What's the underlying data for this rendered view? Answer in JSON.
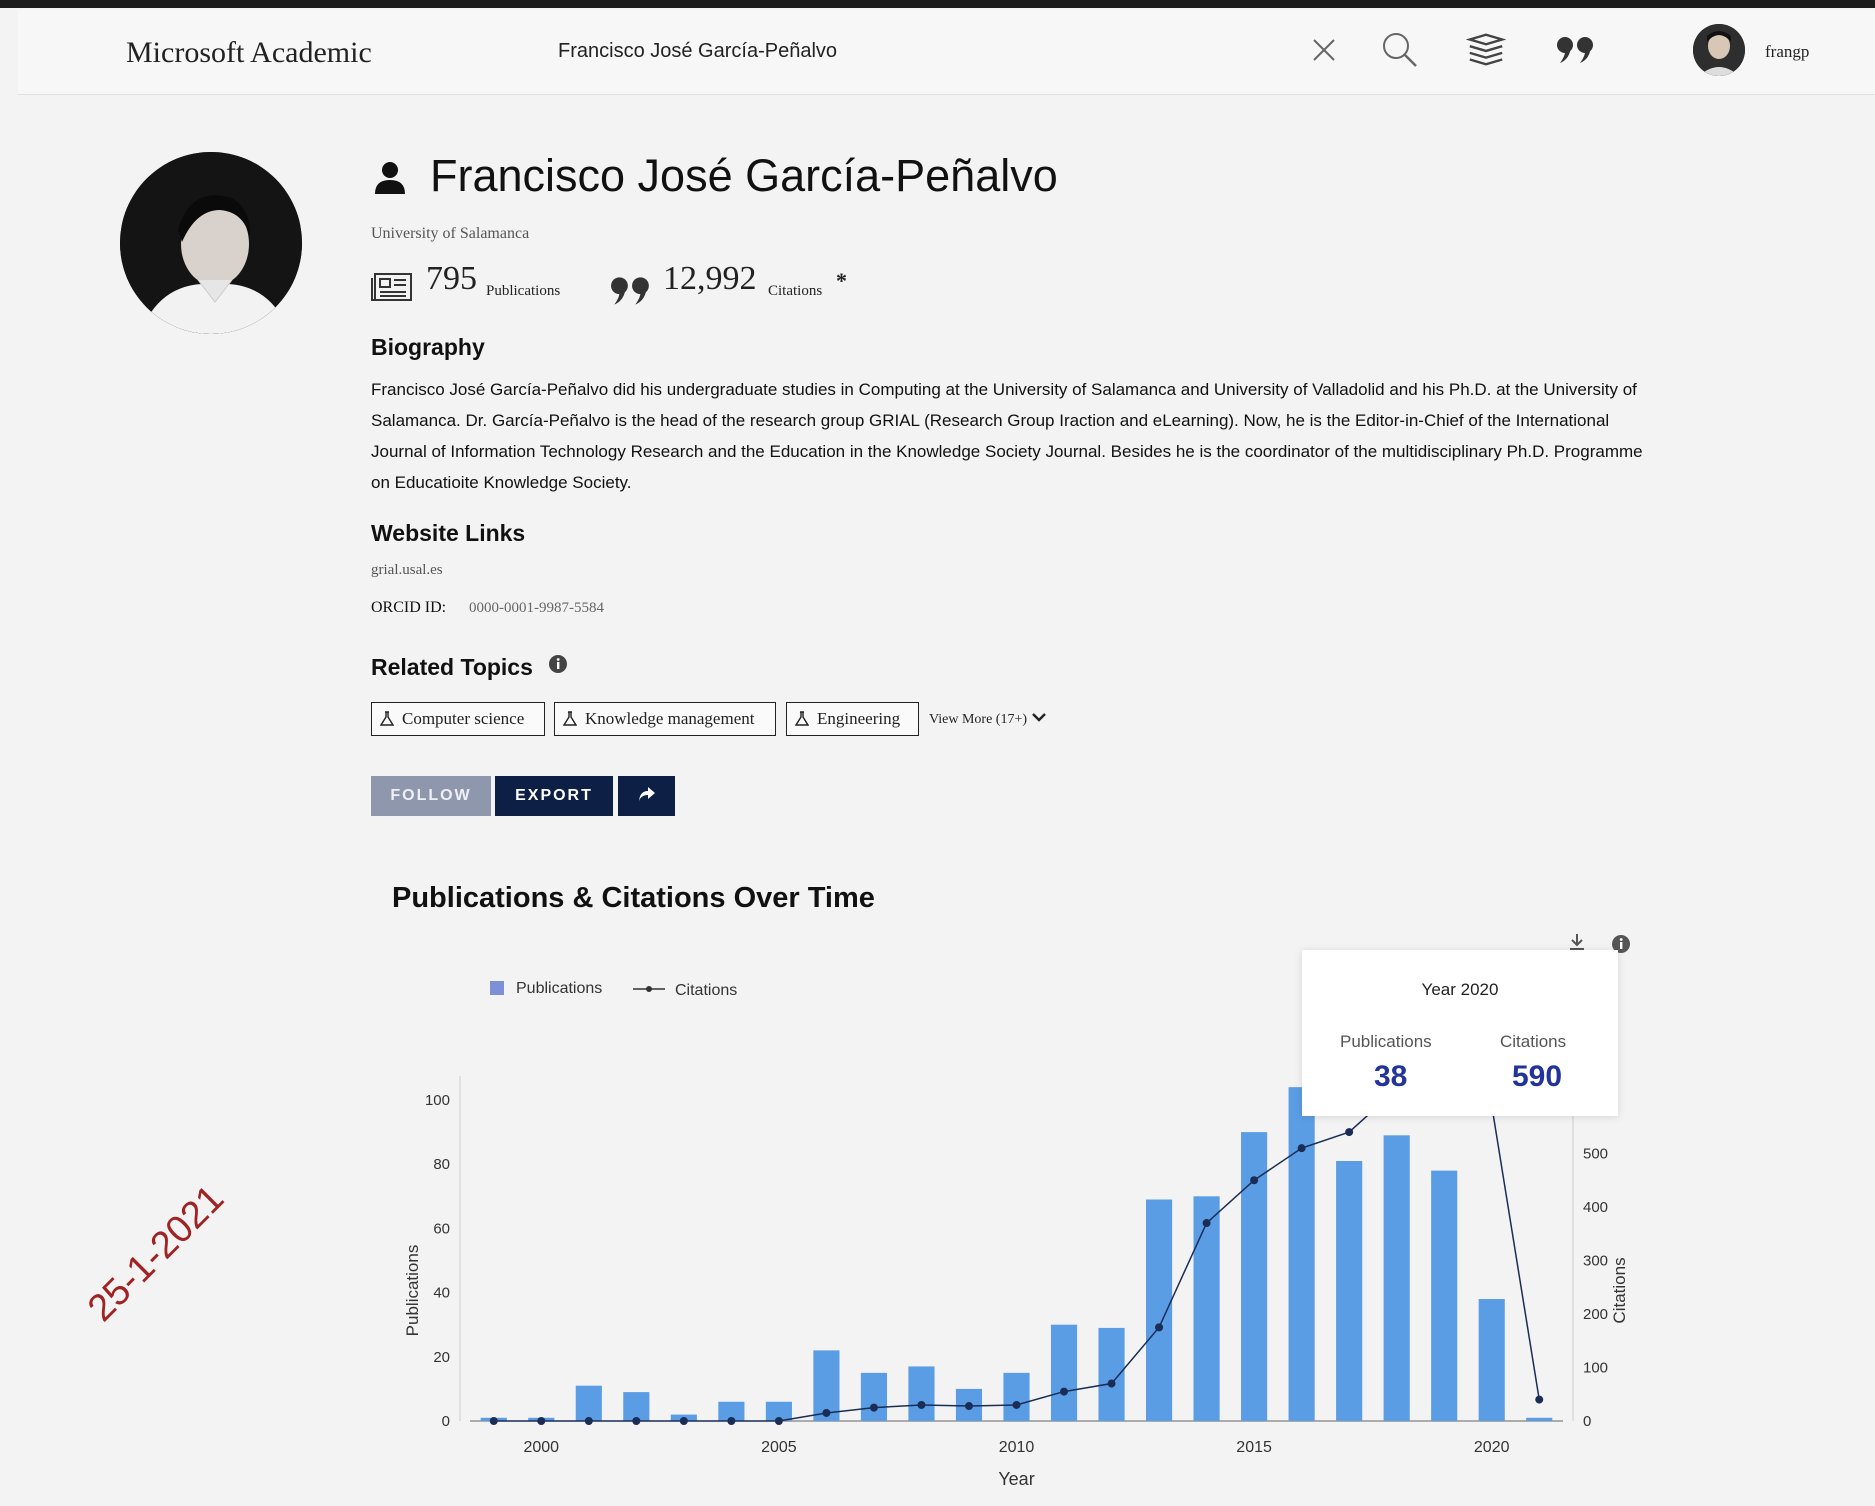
{
  "header": {
    "brand": "Microsoft Academic",
    "search_value": "Francisco José García-Peñalvo",
    "username": "frangp"
  },
  "profile": {
    "name": "Francisco José García-Peñalvo",
    "affiliation": "University of Salamanca",
    "publications_count": "795",
    "publications_label": "Publications",
    "citations_count": "12,992",
    "citations_label": "Citations",
    "citations_mark": "*"
  },
  "biography": {
    "heading": "Biography",
    "text": "Francisco José García-Peñalvo did his undergraduate studies in Computing at the University of Salamanca and University of Valladolid and his Ph.D. at the University of Salamanca. Dr. García-Peñalvo is the head of the research group GRIAL (Research Group Iraction and eLearning). Now, he is the Editor-in-Chief of the International Journal of Information Technology Research and the Education in the Knowledge Society Journal. Besides he is the coordinator of the multidisciplinary Ph.D. Programme on Educatioite Knowledge Society."
  },
  "links": {
    "heading": "Website Links",
    "website": "grial.usal.es",
    "orcid_label": "ORCID ID:",
    "orcid_value": "0000-0001-9987-5584"
  },
  "topics": {
    "heading": "Related Topics",
    "items": [
      "Computer science",
      "Knowledge management",
      "Engineering"
    ],
    "view_more": "View More (17+)"
  },
  "actions": {
    "follow": "FOLLOW",
    "export": "EXPORT"
  },
  "tooltip": {
    "year_label": "Year 2020",
    "publications_label": "Publications",
    "publications_value": "38",
    "citations_label": "Citations",
    "citations_value": "590"
  },
  "stamp": "25-1-2021",
  "colors": {
    "bar": "#5b9de4",
    "line": "#1a2d56",
    "button_dark": "#0d1f45",
    "button_muted": "#8f97ad",
    "tooltip_value": "#22339a"
  },
  "chart_data": {
    "type": "bar",
    "title": "Publications & Citations Over Time",
    "xlabel": "Year",
    "ylabel": "Publications",
    "y2label": "Citations",
    "x": [
      1999,
      2000,
      2001,
      2002,
      2003,
      2004,
      2005,
      2006,
      2007,
      2008,
      2009,
      2010,
      2011,
      2012,
      2013,
      2014,
      2015,
      2016,
      2017,
      2018,
      2019,
      2020,
      2021
    ],
    "x_ticks": [
      2000,
      2005,
      2010,
      2015,
      2020
    ],
    "ylim": [
      0,
      100
    ],
    "y_ticks": [
      0,
      20,
      40,
      60,
      80,
      100
    ],
    "y2lim": [
      0,
      600
    ],
    "y2_ticks": [
      0,
      100,
      200,
      300,
      400,
      500,
      600
    ],
    "legend": [
      "Publications",
      "Citations"
    ],
    "legend_position": "top-left",
    "grid": false,
    "series": [
      {
        "name": "Publications",
        "type": "bar",
        "axis": "left",
        "values": [
          1,
          1,
          11,
          9,
          2,
          6,
          6,
          22,
          15,
          17,
          10,
          15,
          30,
          29,
          69,
          70,
          90,
          104,
          81,
          89,
          78,
          38,
          1
        ]
      },
      {
        "name": "Citations",
        "type": "line",
        "axis": "right",
        "values": [
          0,
          0,
          0,
          0,
          0,
          0,
          0,
          15,
          25,
          30,
          28,
          30,
          55,
          70,
          175,
          370,
          450,
          510,
          540,
          620,
          640,
          590,
          40
        ]
      }
    ]
  }
}
